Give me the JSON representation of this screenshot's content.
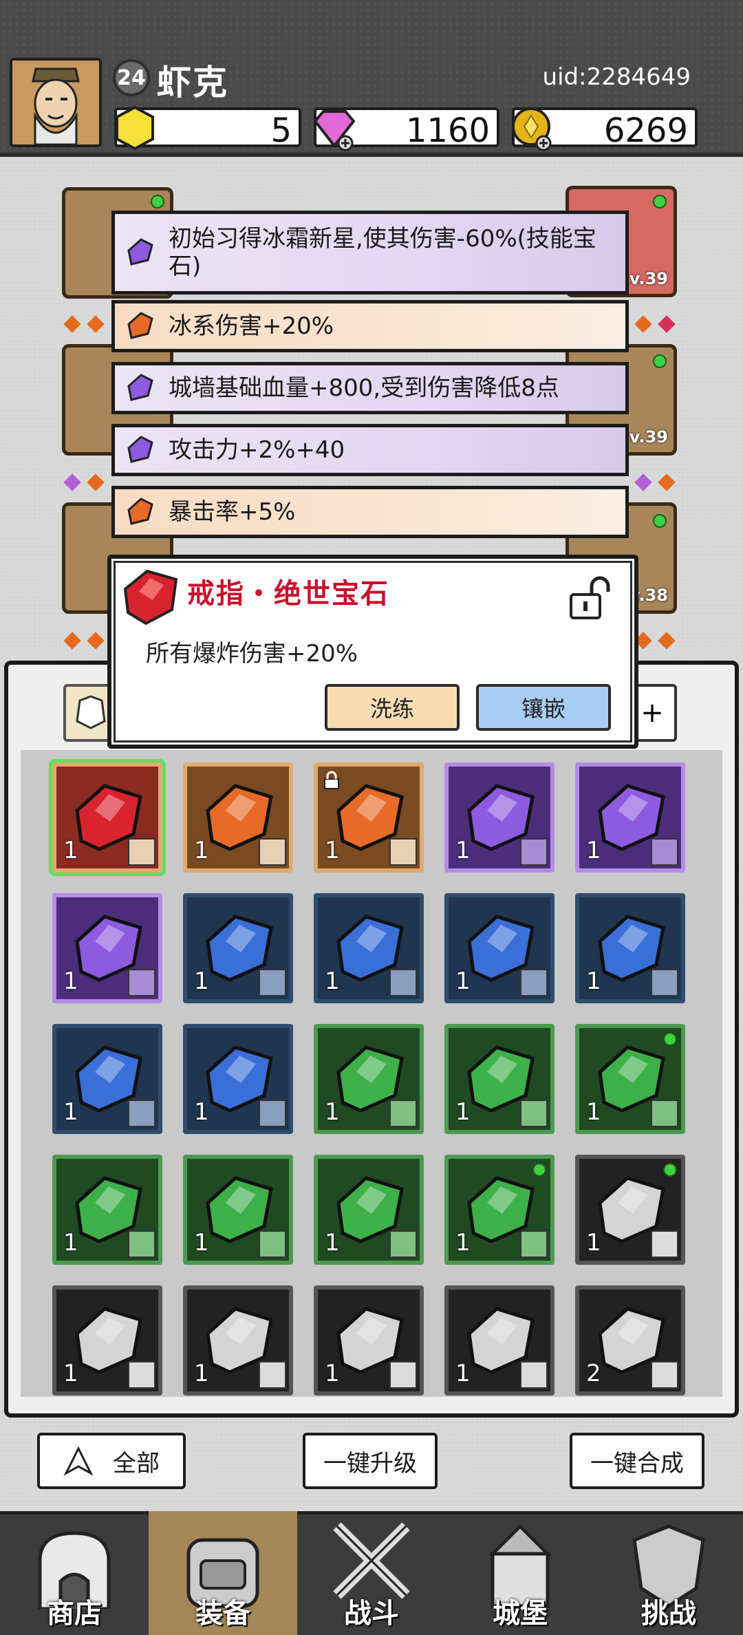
{
  "player": {
    "level": "24",
    "name": "虾克",
    "uid": "uid:2284649"
  },
  "currencies": [
    {
      "icon": "yellow-gem-icon",
      "value": "5"
    },
    {
      "icon": "purple-diamond-icon",
      "value": "1160"
    },
    {
      "icon": "gold-coin-icon",
      "value": "6269"
    }
  ],
  "equipment": {
    "levels": [
      "Lv.39",
      "Lv.39",
      "Lv.38"
    ]
  },
  "stats": [
    {
      "color": "purple",
      "text": "初始习得冰霜新星,使其伤害-60%(技能宝石)"
    },
    {
      "color": "orange",
      "text": "冰系伤害+20%"
    },
    {
      "color": "purple",
      "text": "城墙基础血量+800,受到伤害降低8点"
    },
    {
      "color": "purple",
      "text": "攻击力+2%+40"
    },
    {
      "color": "orange",
      "text": "暴击率+5%"
    }
  ],
  "popup": {
    "title": "戒指・绝世宝石",
    "description": "所有爆炸伤害+20%",
    "refine_label": "洗练",
    "inlay_label": "镶嵌"
  },
  "inventory": {
    "filter_suffix": "+",
    "rows": [
      [
        {
          "rarity": "red",
          "count": "1",
          "slot": "ring"
        },
        {
          "rarity": "orange",
          "count": "1",
          "slot": "armor"
        },
        {
          "rarity": "orange",
          "count": "1",
          "slot": "weapon",
          "locked": true
        },
        {
          "rarity": "purple",
          "count": "1",
          "slot": "armor"
        },
        {
          "rarity": "purple",
          "count": "1",
          "slot": "boots"
        }
      ],
      [
        {
          "rarity": "purple",
          "count": "1",
          "slot": "weapon"
        },
        {
          "rarity": "blue",
          "count": "1",
          "slot": "shield"
        },
        {
          "rarity": "blue",
          "count": "1",
          "slot": "ring"
        },
        {
          "rarity": "blue",
          "count": "1",
          "slot": "necklace"
        },
        {
          "rarity": "blue",
          "count": "1",
          "slot": "necklace"
        }
      ],
      [
        {
          "rarity": "blue",
          "count": "1",
          "slot": "necklace"
        },
        {
          "rarity": "blue",
          "count": "1",
          "slot": "necklace"
        },
        {
          "rarity": "green",
          "count": "1",
          "slot": "armor"
        },
        {
          "rarity": "green",
          "count": "1",
          "slot": "armor"
        },
        {
          "rarity": "green",
          "count": "1",
          "slot": "weapon",
          "dot": true
        }
      ],
      [
        {
          "rarity": "green",
          "count": "1",
          "slot": "weapon"
        },
        {
          "rarity": "green",
          "count": "1",
          "slot": "weapon"
        },
        {
          "rarity": "green",
          "count": "1",
          "slot": "weapon"
        },
        {
          "rarity": "green",
          "count": "1",
          "slot": "necklace",
          "dot": true
        },
        {
          "rarity": "gray",
          "count": "1",
          "slot": "shield",
          "dot": true
        }
      ],
      [
        {
          "rarity": "gray",
          "count": "1",
          "slot": "shield"
        },
        {
          "rarity": "gray",
          "count": "1",
          "slot": "shield"
        },
        {
          "rarity": "gray",
          "count": "1",
          "slot": "armor"
        },
        {
          "rarity": "gray",
          "count": "1",
          "slot": "armor"
        },
        {
          "rarity": "gray",
          "count": "2",
          "slot": "armor"
        }
      ]
    ]
  },
  "actions": {
    "all_label": "全部",
    "upgrade_label": "一键升级",
    "merge_label": "一键合成"
  },
  "nav": [
    {
      "label": "商店",
      "icon": "shop-icon"
    },
    {
      "label": "装备",
      "icon": "backpack-icon",
      "active": true
    },
    {
      "label": "战斗",
      "icon": "crossed-swords-icon"
    },
    {
      "label": "城堡",
      "icon": "castle-icon"
    },
    {
      "label": "挑战",
      "icon": "challenge-shield-icon"
    }
  ],
  "colors": {
    "gem_red": "#d9232e",
    "gem_orange": "#e76a28",
    "gem_purple": "#8c5be0",
    "gem_blue": "#3a6fd8",
    "gem_green": "#3db04a",
    "gem_gray": "#d4d4d4",
    "popup_title": "#c8102e"
  }
}
